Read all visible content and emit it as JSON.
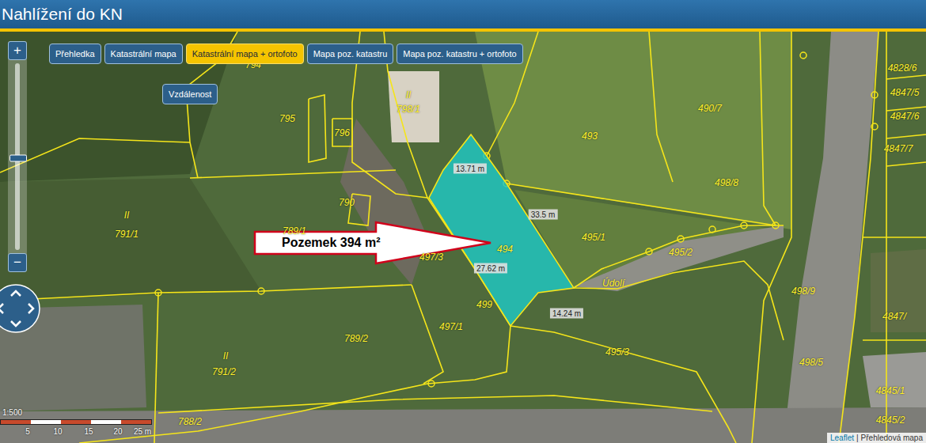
{
  "header": {
    "title": "Nahlížení do KN"
  },
  "layer_buttons": [
    {
      "label": "Přehledka",
      "selected": false
    },
    {
      "label": "Katastrální mapa",
      "selected": false
    },
    {
      "label": "Katastrální mapa + ortofoto",
      "selected": true
    },
    {
      "label": "Mapa poz. katastru",
      "selected": false
    },
    {
      "label": "Mapa poz. katastru + ortofoto",
      "selected": false
    }
  ],
  "tool_button": {
    "label": "Vzdálenost"
  },
  "zoom": {
    "in": "+",
    "out": "−",
    "level": 0.49
  },
  "callout": {
    "text": "Pozemek 394 m²"
  },
  "measurements": [
    "13.71 m",
    "33.5 m",
    "27.62 m",
    "14.24 m"
  ],
  "parcel_labels": [
    "794",
    "795",
    "796",
    "798/1",
    "II",
    "II",
    "II",
    "493",
    "490/7",
    "4828/6",
    "4847/5",
    "4847/6",
    "4847/7",
    "498/8",
    "790",
    "791/1",
    "789/1",
    "494",
    "495/1",
    "495/2",
    "497/3",
    "499",
    "497/1",
    "789/2",
    "791/2",
    "Údolí",
    "495/3",
    "498/9",
    "498/5",
    "4847/",
    "4845/1",
    "788/2",
    "4845/2"
  ],
  "scale": {
    "ratio": "1:500",
    "ticks": [
      "5",
      "10",
      "15",
      "20",
      "25 m"
    ]
  },
  "attribution": {
    "link": "Leaflet",
    "separator": "|",
    "text": "Přehledová mapa"
  }
}
